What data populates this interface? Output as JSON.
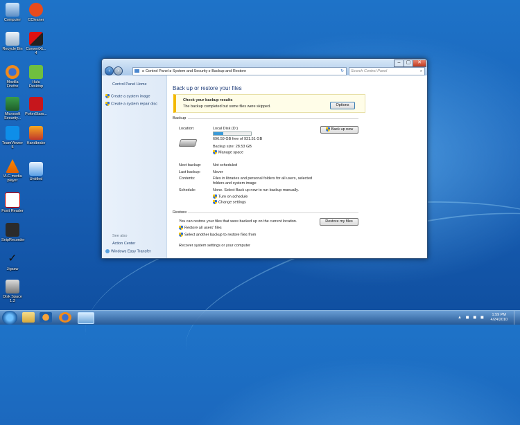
{
  "desktop": {
    "icons": [
      {
        "label": "Computer"
      },
      {
        "label": "CCleaner"
      },
      {
        "label": "Recycle Bin"
      },
      {
        "label": "ConvertXt... 4"
      },
      {
        "label": "Mozilla Firefox"
      },
      {
        "label": "Hulu Desktop"
      },
      {
        "label": "Microsoft Security..."
      },
      {
        "label": "PokerStars..."
      },
      {
        "label": "TeamViewer 5"
      },
      {
        "label": "Handbrake"
      },
      {
        "label": "VLC media player"
      },
      {
        "label": "Untitled"
      },
      {
        "label": "Foxit Reader"
      },
      {
        "label": "SnipRecorder"
      },
      {
        "label": "Jigsaw"
      },
      {
        "label": "Disk Space 1.3"
      }
    ]
  },
  "window": {
    "breadcrumb": [
      "Control Panel",
      "System and Security",
      "Backup and Restore"
    ],
    "search_placeholder": "Search Control Panel",
    "controls": {
      "minimize": "–",
      "maximize": "▢",
      "close": "✕"
    }
  },
  "left_pane": {
    "home": "Control Panel Home",
    "tasks": [
      "Create a system image",
      "Create a system repair disc"
    ],
    "see_also_heading": "See also",
    "see_also": [
      "Action Center",
      "Windows Easy Transfer"
    ]
  },
  "main": {
    "title": "Back up or restore your files",
    "alert": {
      "heading": "Check your backup results",
      "text": "The backup completed but some files were skipped.",
      "button": "Options"
    },
    "backup": {
      "heading": "Backup",
      "location_label": "Location:",
      "location_value": "Local Disk (D:)",
      "disk_used_fraction": 0.25,
      "free_text": "696.59 GB free of 931.51 GB",
      "backup_size": "Backup size: 28.53 GB",
      "manage_space": "Manage space",
      "backup_now": "Back up now",
      "next_label": "Next backup:",
      "next_value": "Not scheduled",
      "last_label": "Last backup:",
      "last_value": "Never",
      "contents_label": "Contents:",
      "contents_value_1": "Files in libraries and personal folders for all users, selected",
      "contents_value_2": "folders and system image",
      "schedule_label": "Schedule:",
      "schedule_value": "None. Select Back up now to run backup manually.",
      "turn_on": "Turn on schedule",
      "change_settings": "Change settings"
    },
    "restore": {
      "heading": "Restore",
      "text": "You can restore your files that were backed up on the current location.",
      "restore_button": "Restore my files",
      "restore_all": "Restore all users' files",
      "select_another": "Select another backup to restore files from",
      "recover": "Recover system settings or your computer"
    }
  },
  "taskbar": {
    "time": "1:59 PM",
    "date": "4/24/2010"
  }
}
